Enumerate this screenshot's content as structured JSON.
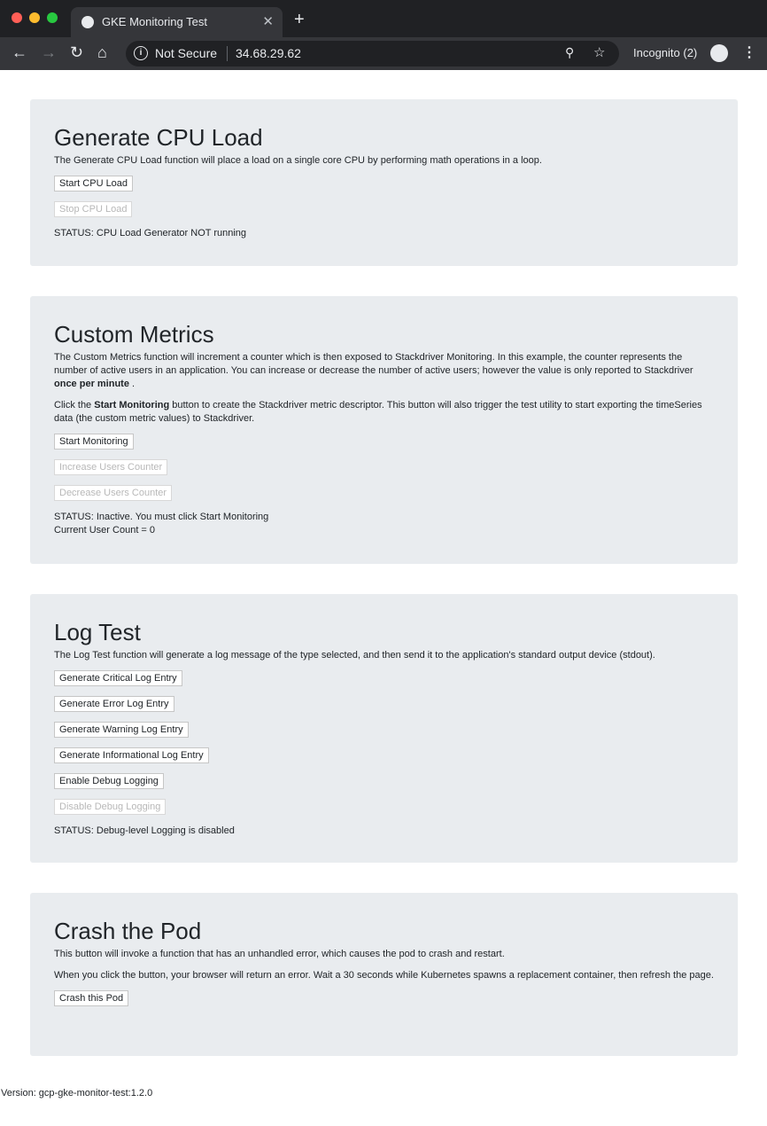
{
  "browser": {
    "tab_title": "GKE Monitoring Test",
    "security": "Not Secure",
    "url": "34.68.29.62",
    "profile": "Incognito (2)"
  },
  "cpu": {
    "title": "Generate CPU Load",
    "desc": "The Generate CPU Load function will place a load on a single core CPU by performing math operations in a loop.",
    "start": "Start CPU Load",
    "stop": "Stop CPU Load",
    "status": "STATUS: CPU Load Generator NOT running"
  },
  "metrics": {
    "title": "Custom Metrics",
    "desc1": "The Custom Metrics function will increment a counter which is then exposed to Stackdriver Monitoring. In this example, the counter represents the number of active users in an application. You can increase or decrease the number of active users; however the value is only reported to Stackdriver ",
    "desc1_bold": "once per minute",
    "desc1_end": " .",
    "desc2_a": "Click the ",
    "desc2_bold": "Start Monitoring",
    "desc2_b": " button to create the Stackdriver metric descriptor. This button will also trigger the test utility to start exporting the timeSeries data (the custom metric values) to Stackdriver.",
    "start": "Start Monitoring",
    "increase": "Increase Users Counter",
    "decrease": "Decrease Users Counter",
    "status": "STATUS: Inactive. You must click Start Monitoring",
    "count": "Current User Count = 0"
  },
  "log": {
    "title": "Log Test",
    "desc": "The Log Test function will generate a log message of the type selected, and then send it to the application's standard output device (stdout).",
    "critical": "Generate Critical Log Entry",
    "error": "Generate Error Log Entry",
    "warning": "Generate Warning Log Entry",
    "info": "Generate Informational Log Entry",
    "enable": "Enable Debug Logging",
    "disable": "Disable Debug Logging",
    "status": "STATUS: Debug-level Logging is disabled"
  },
  "crash": {
    "title": "Crash the Pod",
    "desc1": "This button will invoke a function that has an unhandled error, which causes the pod to crash and restart.",
    "desc2": "When you click the button, your browser will return an error. Wait a 30 seconds while Kubernetes spawns a replacement container, then refresh the page.",
    "button": "Crash this Pod"
  },
  "version": "Version: gcp-gke-monitor-test:1.2.0"
}
